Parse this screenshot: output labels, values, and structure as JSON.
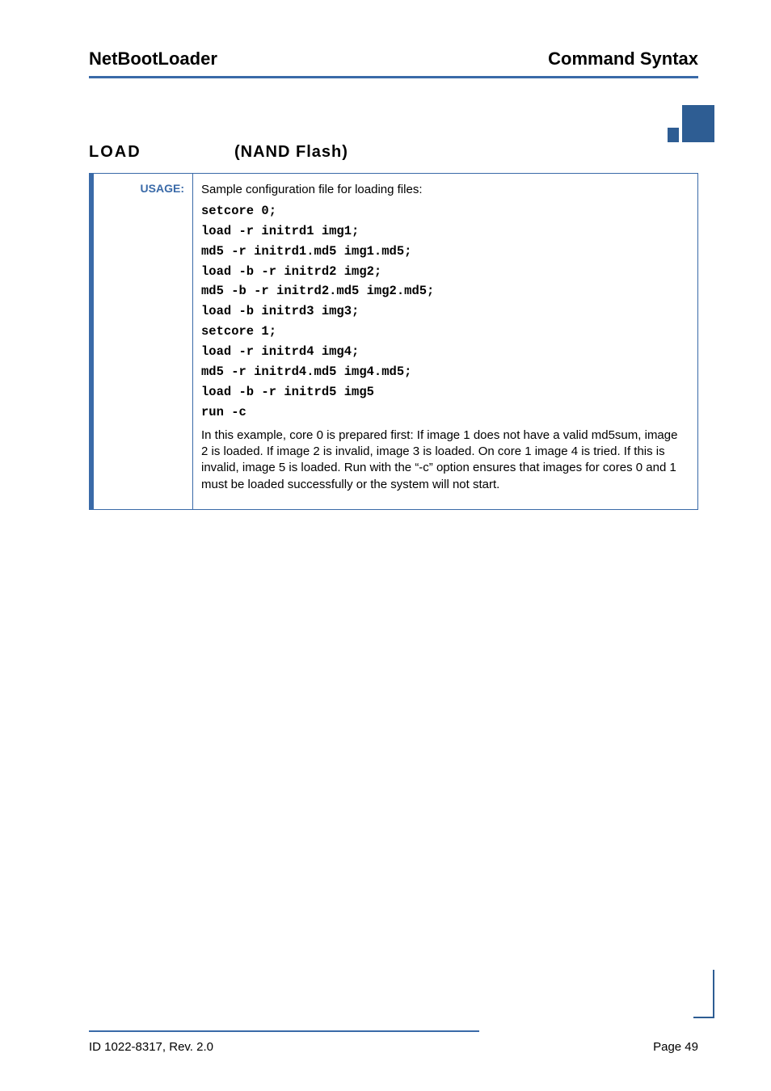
{
  "header": {
    "left": "NetBootLoader",
    "right": "Command Syntax"
  },
  "section": {
    "cmd": "LOAD",
    "sub": "(NAND Flash)"
  },
  "usage": {
    "label": "USAGE:",
    "intro": "Sample configuration file for loading files:",
    "code": [
      "setcore 0;",
      "load -r initrd1 img1;",
      "md5 -r initrd1.md5 img1.md5;",
      "load -b -r initrd2 img2;",
      "md5 -b -r initrd2.md5 img2.md5;",
      "load -b initrd3 img3;",
      "setcore 1;",
      "load -r initrd4 img4;",
      "md5 -r initrd4.md5 img4.md5;",
      "load -b -r initrd5 img5",
      "run -c"
    ],
    "explain": "In this example, core 0 is prepared first: If image 1 does not have a valid md5sum, image 2 is loaded. If image 2 is invalid, image 3 is loaded. On core 1 image 4 is tried. If this is invalid, image 5 is loaded. Run with the “-c” option ensures that images for cores 0 and 1 must be loaded successfully or the system will not start."
  },
  "footer": {
    "left": "ID 1022-8317, Rev. 2.0",
    "right": "Page 49"
  }
}
